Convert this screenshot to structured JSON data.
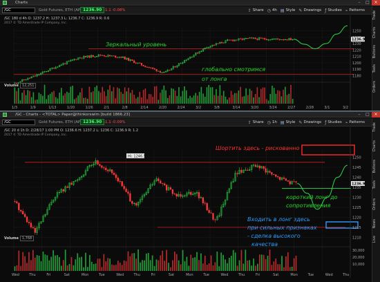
{
  "colors": {
    "bg": "#0b0b0b",
    "up": "#2ee84e",
    "down": "#ff3b3b",
    "red_level": "#d21f1f",
    "projection": "#2edc4a",
    "annotation_green": "#27d62b",
    "annotation_red": "#ff3030",
    "annotation_blue": "#2f9bff",
    "accent_badge": "#1f7a35"
  },
  "top": {
    "title": "Charts",
    "symbol": "/GC",
    "description": "Gold Futures, ETH (APR 17)",
    "last": "1236.90",
    "chg": "-1.1",
    "chg_pct": "-0.08%",
    "toolbar": {
      "share": "Share",
      "period": "4h",
      "style": "Style",
      "drawings": "Drawings",
      "studies": "Studies",
      "patterns": "Patterns"
    },
    "info": "/GC 180 d 4h   O: 1237.2   H: 1237.3   L: 1236.7   C: 1236.9   R: 0.6",
    "copyright": "2017 © TD Ameritrade IP Company, Inc.",
    "price_ticks": [
      "1250",
      "1240",
      "1230",
      "1220",
      "1210",
      "1200",
      "1190",
      "1180"
    ],
    "last_tag": "1236.9",
    "vol_label": "Volume",
    "vol_value": "12,251",
    "date_ticks": [
      "1/3",
      "1/9",
      "1/13",
      "1/20",
      "1/26",
      "2/1",
      "2/8",
      "2/14",
      "2/20",
      "2/24",
      "3/2",
      "3/8",
      "3/14",
      "3/20",
      "3/24",
      "2/27",
      "2/28",
      "3/1",
      "3/2"
    ],
    "annotations": {
      "mirror": "Зеркальный уровень",
      "global": "глобально смотримся",
      "long": "от лонга"
    },
    "side_tabs": [
      "Trade",
      "Charts",
      "Buttons",
      "Tools",
      "Orders"
    ]
  },
  "bottom": {
    "title": "/GC - Charts - <TOTAL> Paper@thinkorswim [build 1866.23]",
    "symbol": "/GC",
    "description": "Gold Futures, ETH (APR 17)",
    "last": "1236.90",
    "chg": "-1.1",
    "chg_pct": "-0.09%",
    "toolbar": {
      "share": "Share",
      "period": "1h",
      "style": "Style",
      "drawings": "Drawings",
      "studies": "Studies",
      "patterns": "Patterns"
    },
    "info": "/GC 20 d 1h   D: 2/28/17 1:00 PM   O: 1236.6   H: 1237.2   L: 1236   C: 1236.9   R: 1.2",
    "copyright": "2017 © TD Ameritrade IP Company, Inc.",
    "hi_label": "Hi: 1246.5",
    "price_ticks": [
      "1250",
      "1245",
      "1240",
      "1235",
      "1230",
      "1225",
      "1220",
      "1215",
      "1210"
    ],
    "last_tag": "1236.9",
    "vol_label": "Volume",
    "vol_value": "1,768",
    "vol_ticks": [
      "30,000",
      "20,000",
      "10,000"
    ],
    "date_ticks": [
      "Wed",
      "Thu",
      "Fri",
      "Sat",
      "Mon",
      "Tue",
      "Wed",
      "Thu",
      "Fri",
      "Sat",
      "Mon",
      "Tue",
      "Wed",
      "Thu",
      "Fri",
      "Sat",
      "Mon",
      "Tue",
      "Wed",
      "Thu"
    ],
    "annotations": {
      "short": "Шортить здесь - рискованно",
      "short_long_1": "короткий лонг до",
      "short_long_2": "сопротивления",
      "long_1": "Входить в лонг здесь",
      "long_2": "при сильных признаках",
      "long_3": "- сделка высокого",
      "long_4": "качества"
    },
    "side_tabs": [
      "Trade",
      "Charts",
      "Buttons",
      "Tools",
      "Orders",
      "News",
      "Live"
    ]
  },
  "chart_data": [
    {
      "type": "candlestick",
      "title": "",
      "timeframe": "180 d 4h",
      "ylim": [
        1175,
        1255
      ],
      "x": [
        "1/3",
        "1/9",
        "1/13",
        "1/20",
        "1/26",
        "2/1",
        "2/8",
        "2/14",
        "2/20",
        "2/24",
        "3/2",
        "3/8",
        "3/14",
        "3/20",
        "3/24"
      ],
      "series": [
        {
          "values": [
            1168,
            1180,
            1195,
            1208,
            1212,
            1209,
            1196,
            1184,
            1205,
            1225,
            1235,
            1238,
            1237,
            1236.9
          ]
        }
      ],
      "levels": [
        {
          "value": 1222
        },
        {
          "value": 1182
        }
      ],
      "projection": [
        1236.9,
        1229,
        1222,
        1230,
        1245,
        1258
      ]
    },
    {
      "type": "candlestick",
      "title": "",
      "timeframe": "20 d 1h",
      "ylim": [
        1207,
        1254
      ],
      "series": [
        {
          "values": [
            1228,
            1212,
            1231,
            1238,
            1248,
            1241,
            1225,
            1239,
            1231,
            1233,
            1218,
            1242,
            1246,
            1240,
            1236.9
          ]
        }
      ],
      "levels": [
        {
          "value": 1247.5
        },
        {
          "value": 1234.5
        },
        {
          "value": 1215
        }
      ],
      "projection": [
        1236.9,
        1232,
        1224,
        1230,
        1240,
        1246
      ]
    }
  ]
}
